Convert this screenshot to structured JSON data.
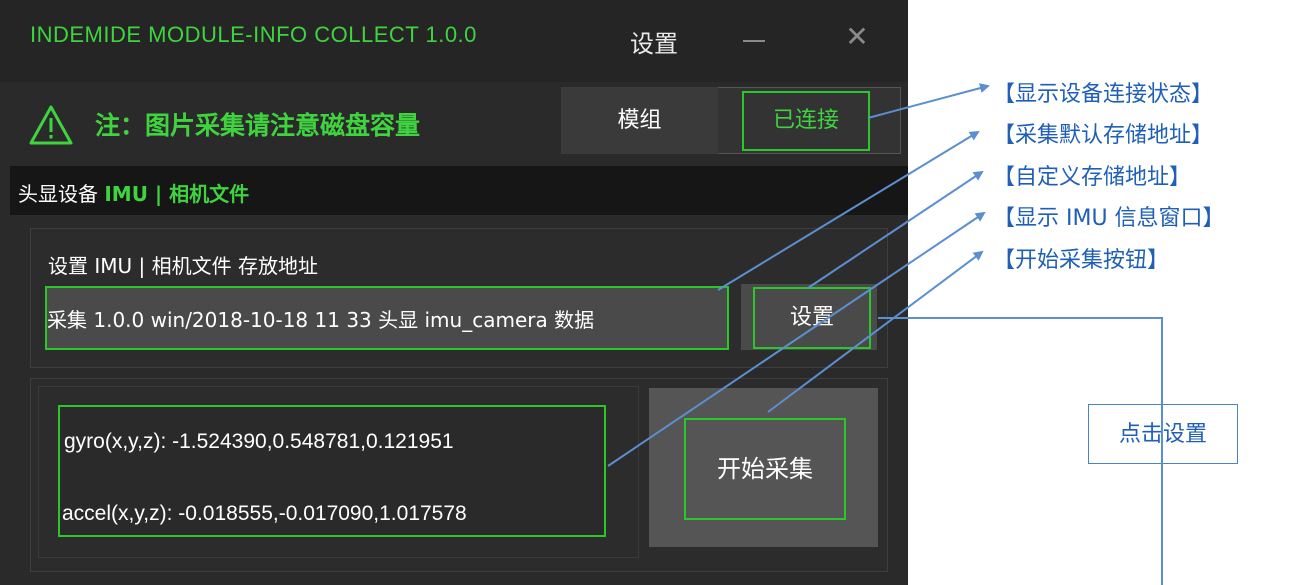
{
  "window": {
    "app_title": "INDEMIDE MODULE-INFO COLLECT 1.0.0",
    "settings_title": "设置",
    "minimize_glyph": "—",
    "close_glyph": "✕"
  },
  "warning": {
    "text": "注：图片采集请注意磁盘容量"
  },
  "connection": {
    "module_label": "模组",
    "status_label": "已连接"
  },
  "section": {
    "prefix": "头显设备",
    "highlight": "IMU | 相机文件"
  },
  "storage": {
    "label": "设置 IMU | 相机文件 存放地址",
    "path_value": "采集 1.0.0 win/2018-10-18 11 33 头显 imu_camera 数据",
    "set_button": "设置"
  },
  "imu": {
    "gyro": "gyro(x,y,z): -1.524390,0.548781,0.121951",
    "accel": "accel(x,y,z): -0.018555,-0.017090,1.017578"
  },
  "actions": {
    "start_button": "开始采集"
  },
  "annotations": {
    "connection_status": "【显示设备连接状态】",
    "default_path": "【采集默认存储地址】",
    "custom_path": "【自定义存储地址】",
    "imu_window": "【显示 IMU 信息窗口】",
    "start_button": "【开始采集按钮】",
    "click_settings": "点击设置"
  },
  "colors": {
    "accent_green": "#3fd43f",
    "annotation_blue": "#1f5fb8",
    "app_background": "#2a2a2a"
  }
}
